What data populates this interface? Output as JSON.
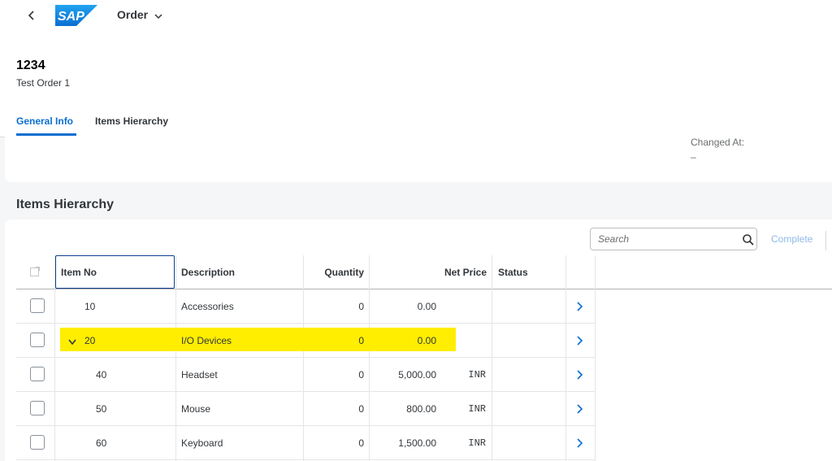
{
  "shell": {
    "logo_text": "SAP",
    "app_title": "Order"
  },
  "object": {
    "id": "1234",
    "description": "Test Order 1"
  },
  "tabs": [
    {
      "label": "General Info",
      "active": true
    },
    {
      "label": "Items Hierarchy",
      "active": false
    }
  ],
  "general_info": {
    "changed_at_label": "Changed At:",
    "changed_at_value": "–"
  },
  "items_section": {
    "title": "Items Hierarchy",
    "search_placeholder": "Search",
    "complete_label": "Complete",
    "columns": [
      "Item No",
      "Description",
      "Quantity",
      "Net Price",
      "Status"
    ],
    "rows": [
      {
        "item_no": "10",
        "description": "Accessories",
        "quantity": "0",
        "net_price": "0.00",
        "currency": "",
        "status": "",
        "level": 0,
        "expandable": false,
        "highlighted": false
      },
      {
        "item_no": "20",
        "description": "I/O Devices",
        "quantity": "0",
        "net_price": "0.00",
        "currency": "",
        "status": "",
        "level": 0,
        "expandable": true,
        "highlighted": true
      },
      {
        "item_no": "40",
        "description": "Headset",
        "quantity": "0",
        "net_price": "5,000.00",
        "currency": "INR",
        "status": "",
        "level": 1,
        "expandable": false,
        "highlighted": false
      },
      {
        "item_no": "50",
        "description": "Mouse",
        "quantity": "0",
        "net_price": "800.00",
        "currency": "INR",
        "status": "",
        "level": 1,
        "expandable": false,
        "highlighted": false
      },
      {
        "item_no": "60",
        "description": "Keyboard",
        "quantity": "0",
        "net_price": "1,500.00",
        "currency": "INR",
        "status": "",
        "level": 1,
        "expandable": false,
        "highlighted": false
      }
    ]
  },
  "colors": {
    "accent": "#0a6ed1",
    "highlight": "#ffee00",
    "logo": "#1a8fe0"
  }
}
